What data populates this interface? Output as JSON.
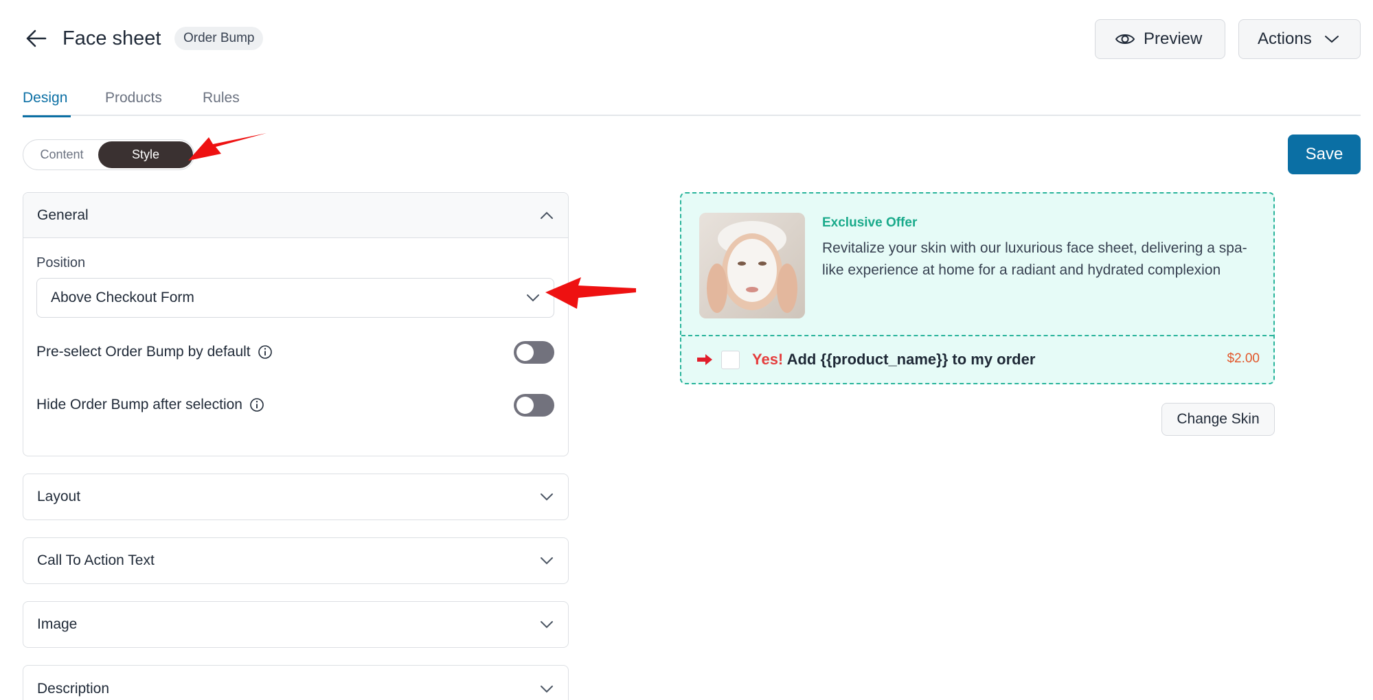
{
  "header": {
    "title": "Face sheet",
    "badge": "Order Bump",
    "preview_label": "Preview",
    "actions_label": "Actions"
  },
  "tabs": [
    {
      "label": "Design",
      "active": true
    },
    {
      "label": "Products",
      "active": false
    },
    {
      "label": "Rules",
      "active": false
    }
  ],
  "mode_toggle": {
    "content_label": "Content",
    "style_label": "Style",
    "selected": "Style"
  },
  "save_label": "Save",
  "panels": {
    "general": {
      "title": "General",
      "expanded": true,
      "position_label": "Position",
      "position_value": "Above Checkout Form",
      "preselect_label": "Pre-select Order Bump by default",
      "preselect_on": false,
      "hide_label": "Hide Order Bump after selection",
      "hide_on": false
    },
    "layout": {
      "title": "Layout"
    },
    "cta": {
      "title": "Call To Action Text"
    },
    "image": {
      "title": "Image"
    },
    "description": {
      "title": "Description"
    }
  },
  "preview": {
    "offer_title": "Exclusive Offer",
    "offer_description": "Revitalize your skin with our luxurious face sheet, delivering a spa-like experience at home for a radiant and hydrated complexion",
    "cta_yes": "Yes!",
    "cta_text": "Add {{product_name}} to my order",
    "price": "$2.00",
    "change_skin_label": "Change Skin"
  },
  "colors": {
    "accent": "#0b6fa4",
    "bump_border": "#27b39a",
    "bump_bg": "#e6fbf7",
    "offer_title": "#1aaa8b",
    "yes_red": "#e53e3e",
    "price": "#e2562a",
    "annotation_arrow": "#ee1111"
  }
}
